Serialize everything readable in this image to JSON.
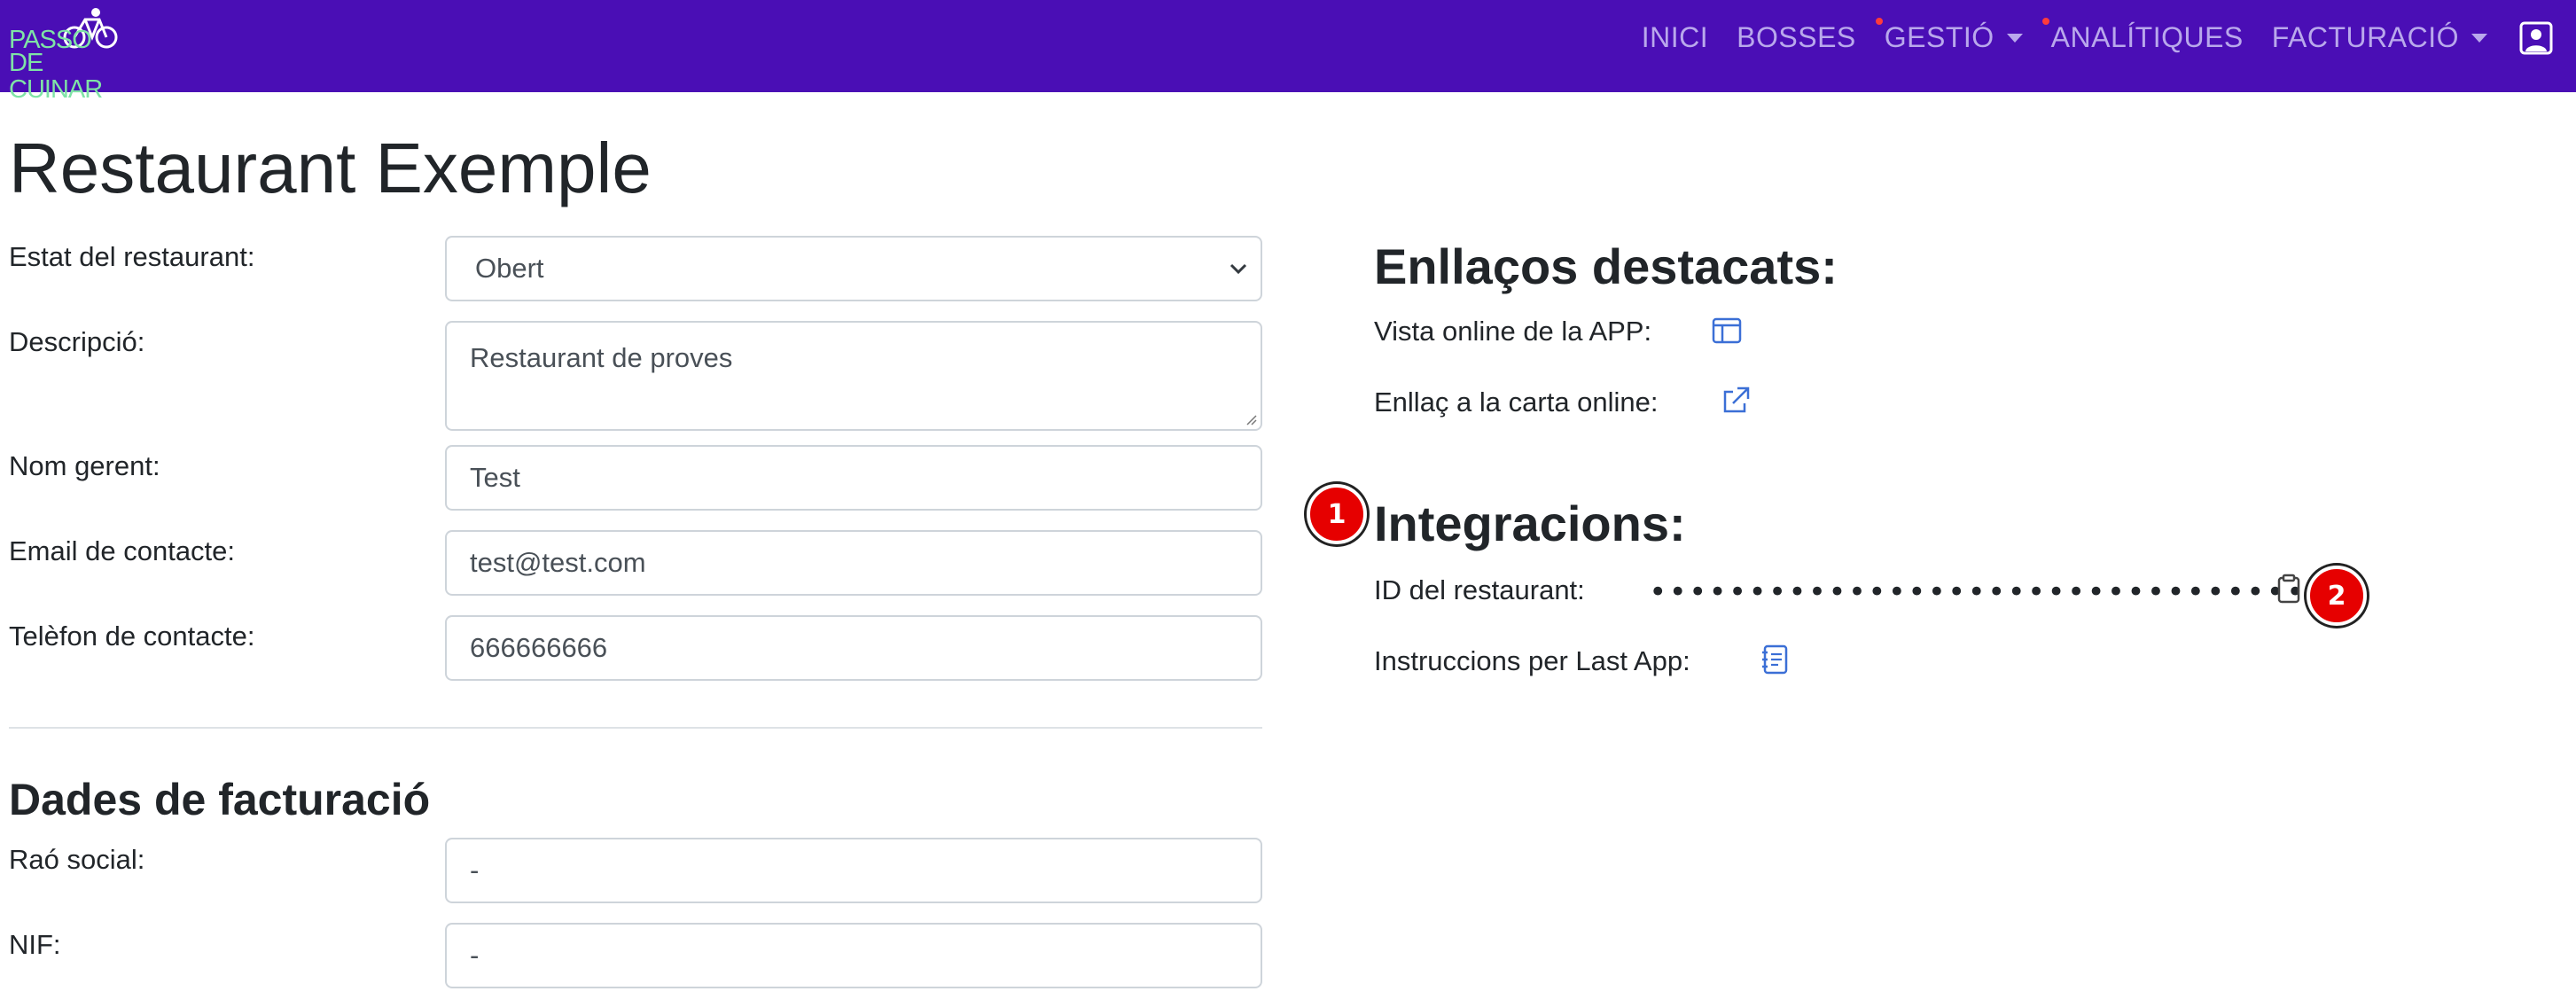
{
  "brand": {
    "logo_line1": "PASSO",
    "logo_line2": "DE CUINAR"
  },
  "nav": {
    "items": [
      {
        "label": "INICI",
        "dot": false,
        "dropdown": false
      },
      {
        "label": "BOSSES",
        "dot": false,
        "dropdown": false
      },
      {
        "label": "GESTIÓ",
        "dot": true,
        "dropdown": true
      },
      {
        "label": "ANALÍTIQUES",
        "dot": true,
        "dropdown": false
      },
      {
        "label": "FACTURACIÓ",
        "dot": false,
        "dropdown": true
      }
    ],
    "user_icon": "user-square-icon"
  },
  "page": {
    "title": "Restaurant Exemple"
  },
  "form": {
    "status_label": "Estat del restaurant:",
    "status_value": "Obert",
    "description_label": "Descripció:",
    "description_value": "Restaurant de proves",
    "manager_label": "Nom gerent:",
    "manager_value": "Test",
    "email_label": "Email de contacte:",
    "email_value": "test@test.com",
    "phone_label": "Telèfon de contacte:",
    "phone_value": "666666666"
  },
  "billing": {
    "heading": "Dades de facturació",
    "social_label": "Raó social:",
    "social_value": "-",
    "nif_label": "NIF:",
    "nif_value": "-"
  },
  "links": {
    "heading": "Enllaços destacats:",
    "app_label": "Vista online de la APP:",
    "menu_label": "Enllaç a la carta online:"
  },
  "integrations": {
    "heading": "Integracions:",
    "id_label": "ID del restaurant:",
    "id_masked": "••••••••••••••••••••••••••••••••••",
    "instructions_label": "Instruccions per Last App:"
  },
  "annotations": {
    "badge1": "1",
    "badge2": "2"
  },
  "colors": {
    "navbar": "#4a0eb5",
    "logo": "#7fe3a6",
    "nav_text": "#b9a8ec",
    "link_icon": "#3b6fd6",
    "badge": "#e60000"
  }
}
